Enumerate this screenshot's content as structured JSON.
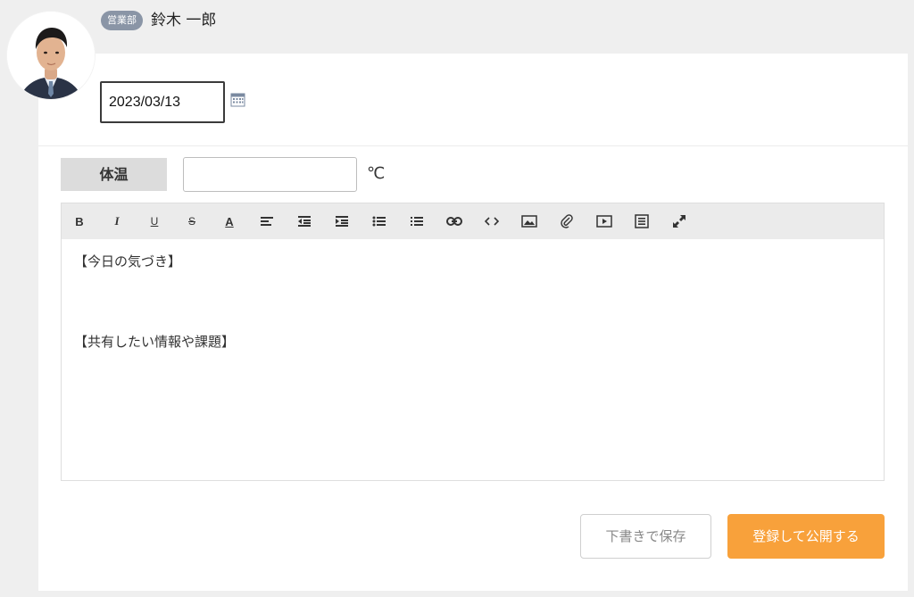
{
  "user": {
    "department": "営業部",
    "name": "鈴木 一郎",
    "avatar_icon": "user-photo"
  },
  "date": {
    "value": "2023/03/13",
    "icon": "calendar-icon"
  },
  "temperature": {
    "label": "体温",
    "value": "",
    "unit": "℃"
  },
  "editor": {
    "toolbar": [
      {
        "name": "bold-button",
        "icon": "bold-icon",
        "glyph": "B"
      },
      {
        "name": "italic-button",
        "icon": "italic-icon",
        "glyph": "I"
      },
      {
        "name": "underline-button",
        "icon": "underline-icon",
        "glyph": "U"
      },
      {
        "name": "strikethrough-button",
        "icon": "strikethrough-icon",
        "glyph": "S"
      },
      {
        "name": "font-color-button",
        "icon": "font-color-icon",
        "glyph": "A"
      },
      {
        "name": "align-button",
        "icon": "align-left-icon"
      },
      {
        "name": "outdent-button",
        "icon": "outdent-icon"
      },
      {
        "name": "indent-button",
        "icon": "indent-icon"
      },
      {
        "name": "bulleted-list-button",
        "icon": "bulleted-list-icon"
      },
      {
        "name": "numbered-list-button",
        "icon": "numbered-list-icon"
      },
      {
        "name": "link-button",
        "icon": "link-icon"
      },
      {
        "name": "code-button",
        "icon": "code-icon"
      },
      {
        "name": "image-button",
        "icon": "image-icon"
      },
      {
        "name": "attachment-button",
        "icon": "paperclip-icon"
      },
      {
        "name": "video-button",
        "icon": "video-icon"
      },
      {
        "name": "blockquote-button",
        "icon": "document-icon"
      },
      {
        "name": "fullscreen-button",
        "icon": "fullscreen-icon"
      }
    ],
    "lines": [
      "【今日の気づき】",
      "【共有したい情報や課題】"
    ]
  },
  "actions": {
    "draft_label": "下書きで保存",
    "publish_label": "登録して公開する"
  },
  "colors": {
    "background": "#efefef",
    "accent": "#f8a13b",
    "badge": "#8a95a6"
  }
}
